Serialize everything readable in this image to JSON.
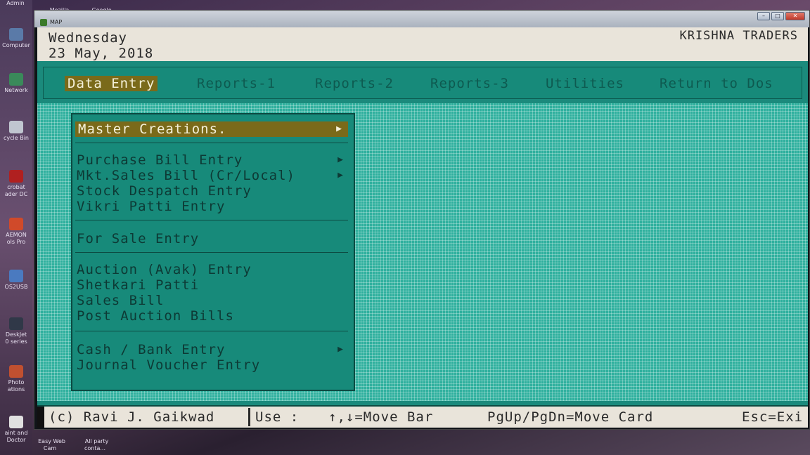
{
  "desktop": {
    "top_icons": [
      {
        "label": "Admin"
      },
      {
        "label": "Mozilla\nFirefox"
      },
      {
        "label": "Google\nChrome"
      }
    ],
    "side_icons": [
      {
        "label": "Computer",
        "color": "#5a7aa8"
      },
      {
        "label": "Network",
        "color": "#3a8a5a"
      },
      {
        "label": "cycle Bin",
        "color": "#c0c6d0"
      },
      {
        "label": "crobat\nader DC",
        "color": "#b02020"
      },
      {
        "label": "AEMON\nols Pro",
        "color": "#d04a2a"
      },
      {
        "label": "OS2USB",
        "color": "#4a7ac0"
      },
      {
        "label": "DeskJet\n0 series",
        "color": "#303848"
      },
      {
        "label": "Photo\nations",
        "color": "#c05030"
      },
      {
        "label": "aint and\nDoctor",
        "color": "#e0e0e0"
      }
    ],
    "bottom_icons": [
      {
        "label": "Easy Web\nCam"
      },
      {
        "label": "All party\nconta..."
      }
    ]
  },
  "window": {
    "title": "MAP",
    "buttons": {
      "minimize": "–",
      "maximize": "□",
      "close": "✕"
    }
  },
  "header": {
    "day": "Wednesday",
    "date": "23 May, 2018",
    "company": "KRISHNA TRADERS"
  },
  "menu": [
    {
      "label": "Data Entry",
      "active": true
    },
    {
      "label": "Reports-1"
    },
    {
      "label": "Reports-2"
    },
    {
      "label": "Reports-3"
    },
    {
      "label": "Utilities"
    },
    {
      "label": "Return to Dos"
    }
  ],
  "dropdown": {
    "items": [
      {
        "label": "Master Creations.",
        "submenu": true,
        "selected": true
      },
      {
        "label": "Purchase Bill Entry",
        "submenu": true
      },
      {
        "label": "Mkt.Sales Bill (Cr/Local)",
        "submenu": true
      },
      {
        "label": "Stock Despatch Entry"
      },
      {
        "label": "Vikri Patti Entry"
      },
      {
        "label": "For Sale Entry"
      },
      {
        "label": "Auction (Avak) Entry"
      },
      {
        "label": "Shetkari Patti"
      },
      {
        "label": "Sales Bill"
      },
      {
        "label": "Post Auction Bills"
      },
      {
        "label": "Cash / Bank Entry",
        "submenu": true
      },
      {
        "label": "Journal Voucher Entry"
      }
    ],
    "arrow": "▶"
  },
  "status": {
    "copyright": "(c) Ravi J. Gaikwad",
    "use_label": "Use :",
    "move_bar": "↑,↓=Move Bar",
    "move_card": "PgUp/PgDn=Move Card",
    "exit": "Esc=Exi"
  },
  "colors": {
    "screen_bg": "#1b8a7c",
    "highlight": "#7a6a1a",
    "header_bg": "#e9e4da"
  }
}
